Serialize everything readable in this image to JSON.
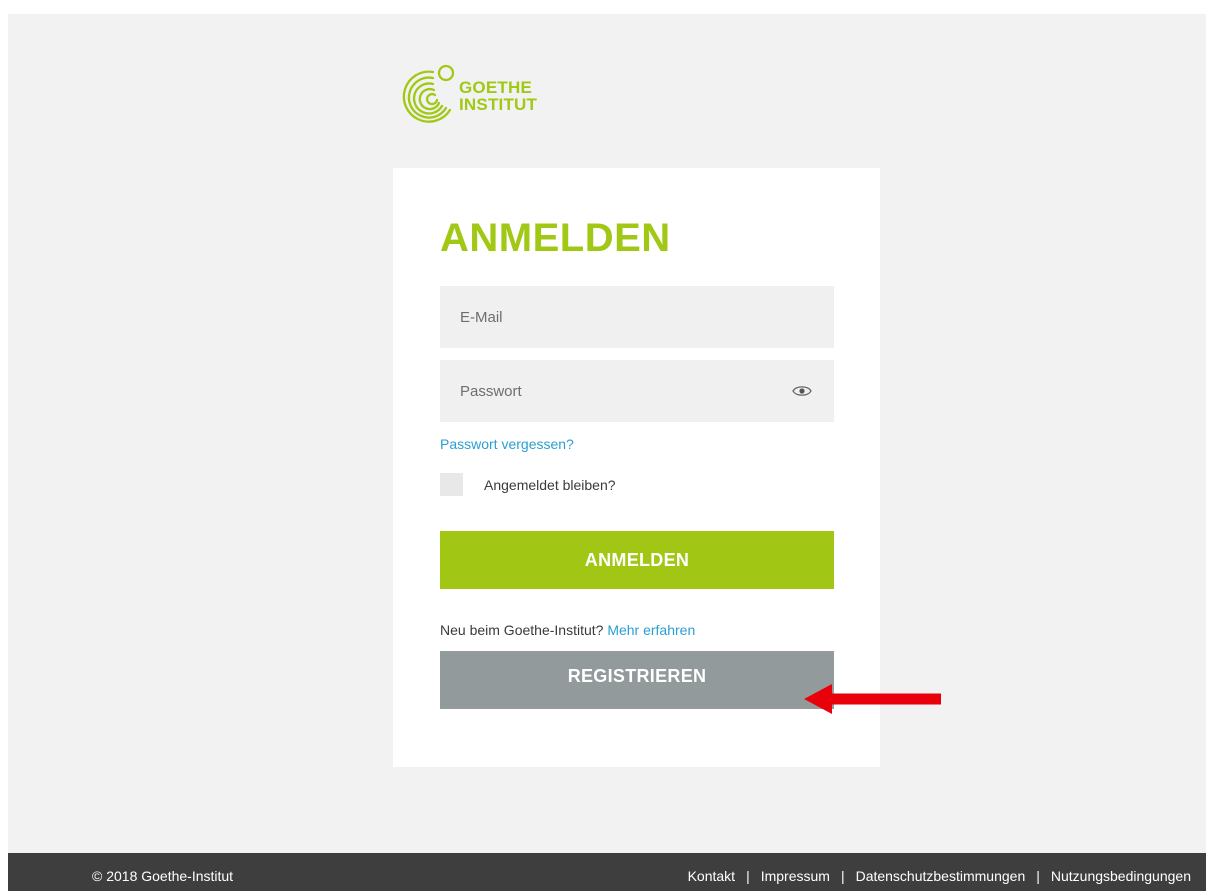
{
  "logo": {
    "line1": "GOETHE",
    "line2": "INSTITUT",
    "icon": "goethe-swirl-logo",
    "color": "#a0c814"
  },
  "login": {
    "title": "ANMELDEN",
    "email_placeholder": "E-Mail",
    "password_placeholder": "Passwort",
    "password_toggle_icon": "eye-icon",
    "forgot_password": "Passwort vergessen?",
    "remember_me": "Angemeldet bleiben?",
    "submit_label": "ANMELDEN",
    "new_text": "Neu beim Goethe-Institut?",
    "learn_more": "Mehr erfahren",
    "register_label": "REGISTRIEREN"
  },
  "annotation": {
    "icon": "red-arrow-left",
    "color": "#e8000b"
  },
  "footer": {
    "copyright": "© 2018 Goethe-Institut",
    "links": [
      "Kontakt",
      "Impressum",
      "Datenschutzbestimmungen",
      "Nutzungsbedingungen"
    ],
    "separator": "|"
  },
  "colors": {
    "accent": "#a2c614",
    "link": "#2b9fd0",
    "register": "#929a9c",
    "footer_bg": "#3e3e3e"
  }
}
